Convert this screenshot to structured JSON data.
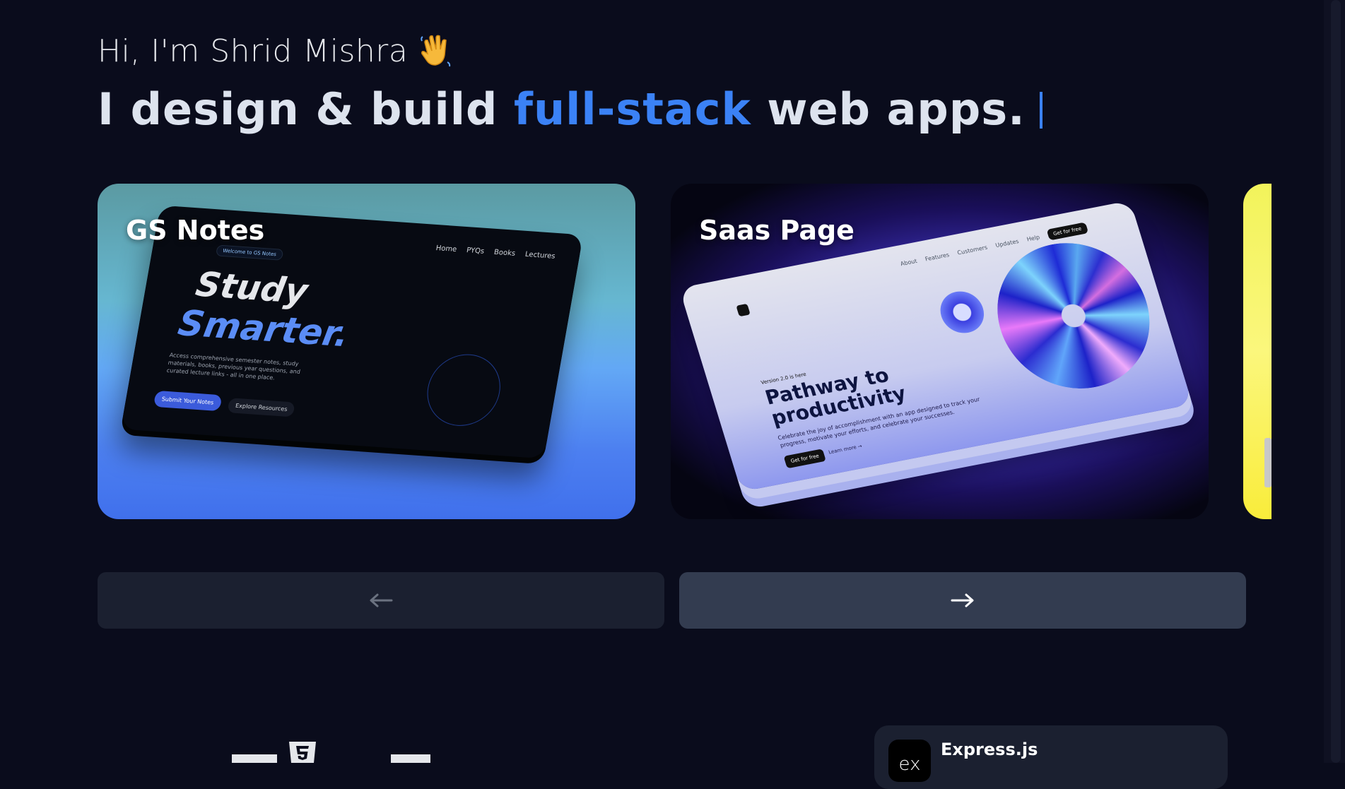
{
  "hero": {
    "greeting": "Hi, I'm Shrid Mishra",
    "headline_before": "I design & build ",
    "headline_accent": "full-stack",
    "headline_after": " web apps.",
    "accent_color": "#3b82f6"
  },
  "projects": [
    {
      "title": "GS Notes",
      "preview": {
        "nav": [
          "Home",
          "PYQs",
          "Books",
          "Lectures"
        ],
        "badge": "Welcome to GS Notes",
        "heading_line1": "Study",
        "heading_line2": "Smarter.",
        "description": "Access comprehensive semester notes, study materials, books, previous year questions, and curated lecture links - all in one place.",
        "primary_button": "Submit Your Notes",
        "secondary_button": "Explore Resources"
      }
    },
    {
      "title": "Saas Page",
      "preview": {
        "nav": [
          "About",
          "Features",
          "Customers",
          "Updates",
          "Help"
        ],
        "nav_button": "Get for free",
        "version": "Version 2.0 is here",
        "heading": "Pathway to productivity",
        "description": "Celebrate the joy of accomplishment with an app designed to track your progress, motivate your efforts, and celebrate your successes.",
        "primary_button": "Get for free",
        "secondary_link": "Learn more →"
      }
    }
  ],
  "carousel": {
    "prev_icon": "←",
    "next_icon": "→"
  },
  "tech": {
    "express_logo": "ex",
    "express_name": "Express.js"
  },
  "icons": {
    "wave": "waving-hand-icon",
    "html": "html5-icon",
    "express": "express-logo-icon"
  }
}
